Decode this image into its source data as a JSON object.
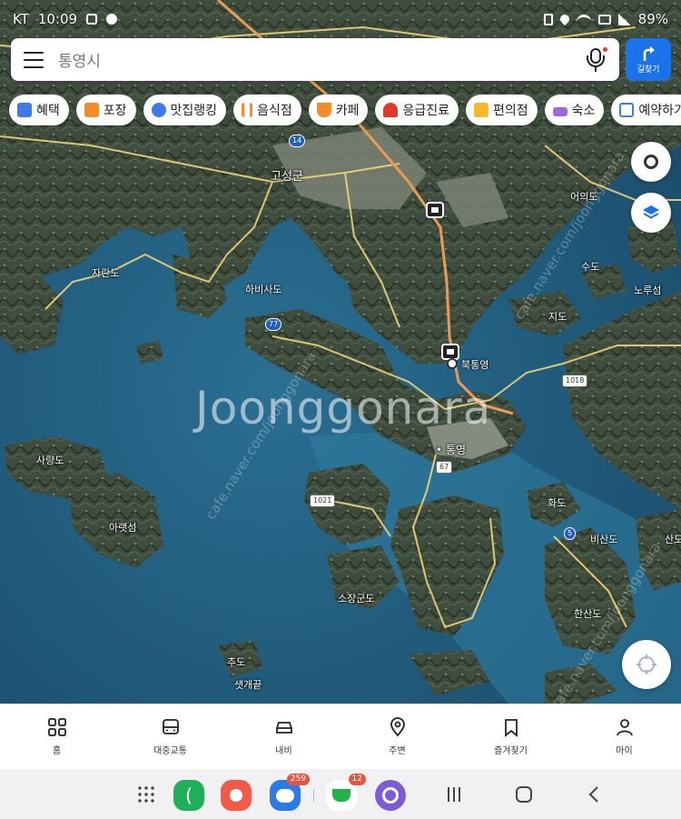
{
  "status_bar": {
    "time": "10:09",
    "prefix": "KT",
    "battery": "89%"
  },
  "search": {
    "value": "통영시"
  },
  "directions": {
    "label": "길찾기"
  },
  "chips": [
    {
      "label": "혜택",
      "icon": "benefit-icon",
      "color": "#3f7be8"
    },
    {
      "label": "포장",
      "icon": "bag-icon",
      "color": "#f08c2a"
    },
    {
      "label": "맛집랭킹",
      "icon": "ranking-icon",
      "color": "#3f7be8"
    },
    {
      "label": "음식점",
      "icon": "utensils-icon",
      "color": "#f08c2a"
    },
    {
      "label": "카페",
      "icon": "coffee-icon",
      "color": "#f08c2a"
    },
    {
      "label": "응급진료",
      "icon": "siren-icon",
      "color": "#e0392b"
    },
    {
      "label": "편의점",
      "icon": "store-icon",
      "color": "#f2b92a"
    },
    {
      "label": "숙소",
      "icon": "bed-icon",
      "color": "#9b6ad8"
    },
    {
      "label": "예약하기",
      "icon": "calendar-icon",
      "color": "#3f7be8"
    }
  ],
  "map": {
    "labels": {
      "goseong": "고성군",
      "jaran": "자란도",
      "habisado": "하비사도",
      "eoui": "어의도",
      "sudo": "수도",
      "noru": "노루섬",
      "jido": "지도",
      "buktongyeong": "북통영",
      "tongyeong": "통영",
      "saryang": "사량도",
      "ahae": "아랫섬",
      "hwado": "화도",
      "bisan": "비산도",
      "sajanggun": "소장군도",
      "hansan": "한산도",
      "chudo": "추도",
      "saegae": "샛개끝",
      "san": "산도"
    },
    "roads": {
      "r14": "14",
      "r77": "77",
      "r67": "67",
      "r1018": "1018",
      "r1021": "1021",
      "r5": "5"
    },
    "watermark": "Joonggonara",
    "watermark_url": "cafe.naver.com/joonggonara"
  },
  "bottom_nav": [
    {
      "label": "홈",
      "icon": "home-grid-icon"
    },
    {
      "label": "대중교통",
      "icon": "bus-icon"
    },
    {
      "label": "내비",
      "icon": "car-icon"
    },
    {
      "label": "주변",
      "icon": "location-pin-icon"
    },
    {
      "label": "즐겨찾기",
      "icon": "bookmark-icon"
    },
    {
      "label": "마이",
      "icon": "user-icon"
    }
  ],
  "dock": {
    "message_badge": "259",
    "cafe_badge": "12"
  }
}
